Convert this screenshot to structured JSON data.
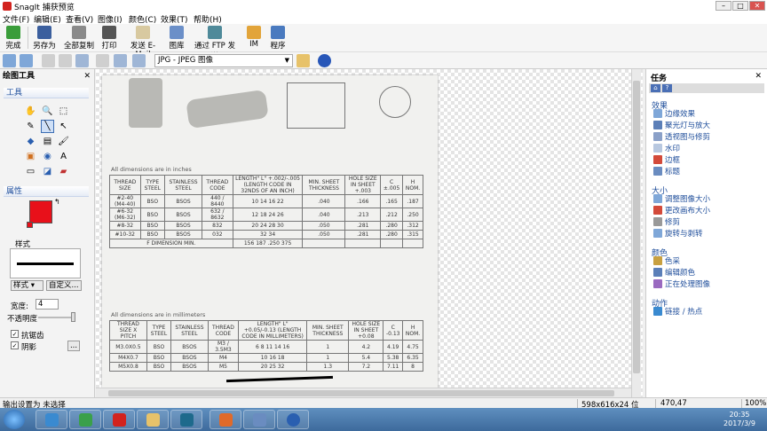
{
  "window": {
    "title": "SnagIt 捕获预览",
    "minimize": "–",
    "maximize": "□",
    "close": "✕"
  },
  "menu": [
    "文件(F)",
    "编辑(E)",
    "查看(V)",
    "图像(I)",
    "颜色(C)",
    "效果(T)",
    "帮助(H)"
  ],
  "toolbar": {
    "finish": "完成",
    "save_as": "另存为",
    "copy_all": "全部复制",
    "print": "打印",
    "email": "发送 E-Mail",
    "library": "图库",
    "ftp": "通过 FTP 发送",
    "im": "IM",
    "program": "程序"
  },
  "format_select": {
    "value": "JPG - JPEG 图像",
    "arrow": "▼"
  },
  "left_panel": {
    "title": "绘图工具",
    "close": "✕",
    "tools_header": "工具",
    "properties_header": "属性",
    "style_label": "样式",
    "style_button": "样式",
    "custom_button": "自定义...",
    "width_label": "宽度:",
    "width_value": "4",
    "opacity_label": "不透明度",
    "opacity_value": 0.95,
    "antialias_label": "抗锯齿",
    "antialias_checked": true,
    "shadow_label": "阴影",
    "shadow_checked": true,
    "shadow_options": "...",
    "color": "#e8101a"
  },
  "tools": [
    {
      "name": "hand-tool",
      "glyph": "✋"
    },
    {
      "name": "zoom-tool",
      "glyph": "🔍"
    },
    {
      "name": "select-tool",
      "glyph": "⬚"
    },
    {
      "name": "pen-tool",
      "glyph": "✎"
    },
    {
      "name": "line-tool",
      "glyph": "╲"
    },
    {
      "name": "arrow-tool",
      "glyph": "↖"
    },
    {
      "name": "shape-tool",
      "glyph": "◆"
    },
    {
      "name": "highlighter-tool",
      "glyph": "▤"
    },
    {
      "name": "brush-tool",
      "glyph": "🖌"
    },
    {
      "name": "stamp-tool",
      "glyph": "▣"
    },
    {
      "name": "fill-tool",
      "glyph": "◉"
    },
    {
      "name": "text-tool",
      "glyph": "A"
    },
    {
      "name": "callout-tool",
      "glyph": "▭"
    },
    {
      "name": "color-picker-tool",
      "glyph": "◪"
    },
    {
      "name": "eraser-tool",
      "glyph": "▰"
    }
  ],
  "document": {
    "inch_caption": "All dimensions are in inches",
    "mm_caption": "All dimensions are in millimeters",
    "inch_headers": [
      "THREAD SIZE",
      "TYPE STEEL",
      "STAINLESS STEEL",
      "THREAD CODE",
      "LENGTH\" L\" +.002/-.005 (LENGTH CODE IN 32NDS OF AN INCH)",
      "MIN. SHEET THICKNESS",
      "HOLE SIZE IN SHEET +.003",
      "C ±.005",
      "H NOM."
    ],
    "inch_rows": [
      [
        "#2-40 (M4-40)",
        "BSO",
        "BSOS",
        "440 / 8440",
        "10 14 16 22",
        ".040",
        ".166",
        ".165",
        ".187"
      ],
      [
        "#6-32 (M6-32)",
        "BSO",
        "BSOS",
        "632 / 8632",
        "12 18 24 26",
        ".040",
        ".213",
        ".212",
        ".250"
      ],
      [
        "#8-32",
        "BSO",
        "BSOS",
        "832",
        "20 24 28 30",
        ".050",
        ".281",
        ".280",
        ".312"
      ],
      [
        "#10-32",
        "BSO",
        "BSOS",
        "032",
        "32 34",
        ".050",
        ".281",
        ".280",
        ".315"
      ],
      [
        "F DIMENSION MIN.",
        "",
        "",
        "",
        "156 187 .250 375",
        "",
        "",
        "",
        ""
      ]
    ],
    "mm_headers": [
      "THREAD SIZE X PITCH",
      "TYPE STEEL",
      "STAINLESS STEEL",
      "THREAD CODE",
      "LENGTH\" L\" +0.05/-0.13 (LENGTH CODE IN MILLIMETERS)",
      "MIN. SHEET THICKNESS",
      "HOLE SIZE IN SHEET +0.08",
      "C -0.13",
      "H NOM."
    ],
    "mm_rows": [
      [
        "M3.0X0.5",
        "BSO",
        "BSOS",
        "M3 / 3.5M3",
        "6 8 11 14 16",
        "1",
        "4.2",
        "4.19",
        "4.75"
      ],
      [
        "M4X0.7",
        "BSO",
        "BSOS",
        "M4",
        "10 16 18",
        "1",
        "5.4",
        "5.38",
        "6.35"
      ],
      [
        "M5X0.8",
        "BSO",
        "BSOS",
        "M5",
        "20 25 32",
        "1.3",
        "7.2",
        "7.11",
        "8"
      ]
    ]
  },
  "right_panel": {
    "title": "任务",
    "close": "✕",
    "sections": [
      {
        "name": "效果",
        "items": [
          "边缘效果",
          "聚光灯与放大",
          "透视图与修剪",
          "水印",
          "边框",
          "标题"
        ]
      },
      {
        "name": "大小",
        "items": [
          "调整图像大小",
          "更改画布大小",
          "修剪",
          "旋转与剥转"
        ]
      },
      {
        "name": "颜色",
        "items": [
          "色采",
          "编辑颜色",
          "正在处理图像"
        ]
      },
      {
        "name": "动作",
        "items": [
          "链接 / 热点"
        ]
      }
    ]
  },
  "status": {
    "message": "输出设置为 未选择",
    "dimensions": "598x616x24 位",
    "coords": "470,47",
    "zoom": "100%"
  },
  "clock": {
    "time": "20:35",
    "date": "2017/3/9"
  },
  "colors": {
    "accent_blue": "#1f4e9b",
    "drawing_color": "#e8101a"
  }
}
